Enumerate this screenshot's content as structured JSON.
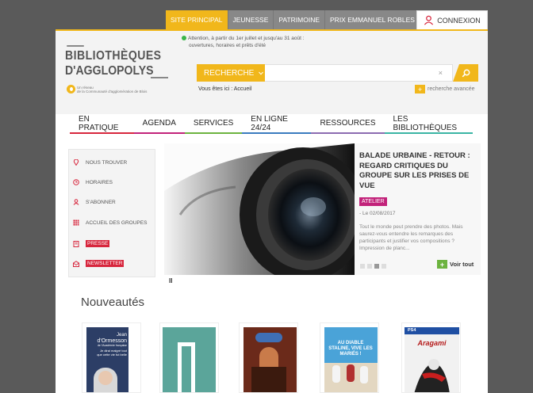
{
  "topnav": {
    "tabs": [
      {
        "label": "SITE PRINCIPAL",
        "active": true
      },
      {
        "label": "JEUNESSE",
        "active": false
      },
      {
        "label": "PATRIMOINE",
        "active": false
      },
      {
        "label": "PRIX EMMANUEL ROBLES",
        "active": false
      }
    ],
    "connexion_label": "CONNEXION",
    "connexion_icon": "user-icon"
  },
  "logo": {
    "line1": "BIBLIOTHÈQUES",
    "line2": "D'AGGLOPOLYS",
    "small_line1": "Un réseau",
    "small_line2": "de la Communauté d'agglomération de Blois"
  },
  "alert": {
    "line1": "Attention, à partir du 1er juillet et jusqu'au 31 août :",
    "line2": "ouvertures, horaires et prêts d'été"
  },
  "search": {
    "scope_label": "RECHERCHE",
    "clear_symbol": "×",
    "advanced_label": "recherche avancée",
    "submit_icon": "search-icon"
  },
  "breadcrumb": {
    "prefix": "Vous êtes ici :",
    "current": "Accueil"
  },
  "mainnav": [
    {
      "label": "EN PRATIQUE",
      "color": "#d7263d"
    },
    {
      "label": "AGENDA",
      "color": "#c2227a"
    },
    {
      "label": "SERVICES",
      "color": "#6cb33f"
    },
    {
      "label": "EN LIGNE 24/24",
      "color": "#3a7bbf"
    },
    {
      "label": "RESSOURCES",
      "color": "#8c6bb1"
    },
    {
      "label": "LES BIBLIOTHÈQUES",
      "color": "#3ab5a4"
    }
  ],
  "sidebar": [
    {
      "label": "NOUS TROUVER",
      "icon": "map-pin-icon",
      "highlight": false
    },
    {
      "label": "HORAIRES",
      "icon": "clock-icon",
      "highlight": false
    },
    {
      "label": "S'ABONNER",
      "icon": "user-icon",
      "highlight": false
    },
    {
      "label": "ACCUEIL DES GROUPES",
      "icon": "grid-icon",
      "highlight": false
    },
    {
      "label": "PRESSE",
      "icon": "newspaper-icon",
      "highlight": true
    },
    {
      "label": "NEWSLETTER",
      "icon": "mail-icon",
      "highlight": true
    }
  ],
  "slide": {
    "title": "BALADE URBAINE - RETOUR : REGARD CRITIQUES DU GROUPE SUR LES PRISES DE VUE",
    "tag": "ATELIER",
    "date": "- Le 02/08/2017",
    "description": "Tout le monde peut prendre des photos. Mais saurez-vous entendre les remarques des participants et justifier vos compositions ? Impression de planc...",
    "voir_label": "Voir tout",
    "pause_symbol": "II",
    "dots_total": 4,
    "dots_active": 3
  },
  "nouveautes": {
    "heading": "Nouveautés",
    "cover1_text1": "Jean",
    "cover1_text2": "d'Ormesson",
    "cover1_text3": "de l'Académie française",
    "cover1_text4": "Je dirai malgré tout",
    "cover1_text5": "que cette vie fut belle",
    "cover4_text": "AU DIABLE STALINE, VIVE LES MARIÉS !",
    "cover5_platform": "PS4",
    "cover5_title": "Aragami"
  },
  "colors": {
    "accent": "#f1b71b",
    "alert_dot": "#3ab54a"
  }
}
